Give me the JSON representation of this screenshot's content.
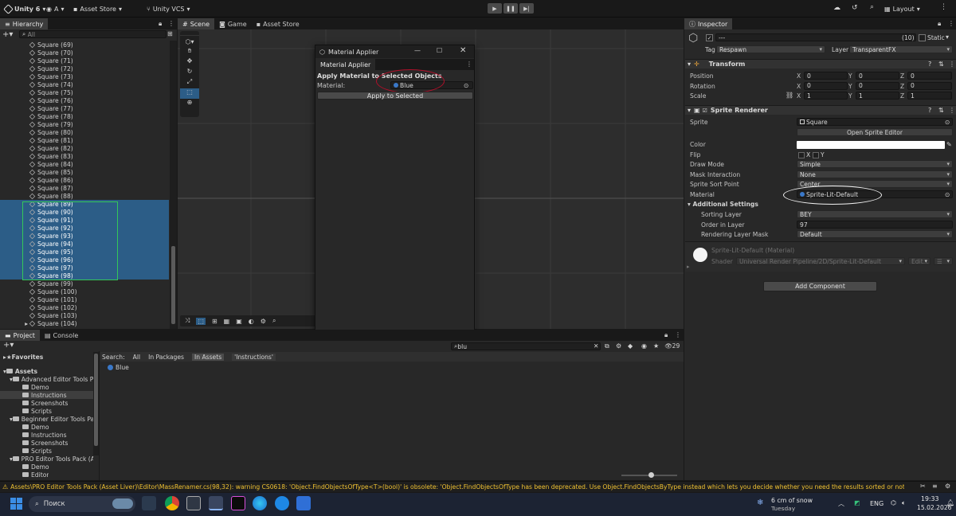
{
  "topbar": {
    "app_name": "Unity 6",
    "account": "A",
    "asset_store": "Asset Store",
    "vcs": "Unity VCS",
    "layout": "Layout"
  },
  "hierarchy": {
    "tab": "Hierarchy",
    "search_placeholder": "All",
    "items": [
      "Square (69)",
      "Square (70)",
      "Square (71)",
      "Square (72)",
      "Square (73)",
      "Square (74)",
      "Square (75)",
      "Square (76)",
      "Square (77)",
      "Square (78)",
      "Square (79)",
      "Square (80)",
      "Square (81)",
      "Square (82)",
      "Square (83)",
      "Square (84)",
      "Square (85)",
      "Square (86)",
      "Square (87)",
      "Square (88)",
      "Square (89)",
      "Square (90)",
      "Square (91)",
      "Square (92)",
      "Square (93)",
      "Square (94)",
      "Square (95)",
      "Square (96)",
      "Square (97)",
      "Square (98)",
      "Square (99)",
      "Square (100)",
      "Square (101)",
      "Square (102)",
      "Square (103)",
      "Square (104)"
    ],
    "selected_from": 20,
    "selected_to": 29
  },
  "scene": {
    "tabs": [
      "Scene",
      "Game",
      "Asset Store"
    ]
  },
  "material_applier": {
    "title": "Material Applier",
    "tab": "Material Applier",
    "heading": "Apply Material to Selected Objects",
    "material_label": "Material:",
    "material_value": "Blue",
    "apply_button": "Apply to Selected"
  },
  "inspector": {
    "tab": "Inspector",
    "object_name": "---",
    "count": "(10)",
    "static_label": "Static",
    "tag_label": "Tag",
    "tag_value": "Respawn",
    "layer_label": "Layer",
    "layer_value": "TransparentFX",
    "transform": {
      "title": "Transform",
      "position_label": "Position",
      "rotation_label": "Rotation",
      "scale_label": "Scale",
      "position": [
        "0",
        "0",
        "0"
      ],
      "rotation": [
        "0",
        "0",
        "0"
      ],
      "scale": [
        "1",
        "1",
        "1"
      ],
      "axes": [
        "X",
        "Y",
        "Z"
      ]
    },
    "sprite_renderer": {
      "title": "Sprite Renderer",
      "sprite_label": "Sprite",
      "sprite_value": "Square",
      "open_editor": "Open Sprite Editor",
      "color_label": "Color",
      "flip_label": "Flip",
      "flip_x": "X",
      "flip_y": "Y",
      "draw_mode_label": "Draw Mode",
      "draw_mode_value": "Simple",
      "mask_label": "Mask Interaction",
      "mask_value": "None",
      "sort_point_label": "Sprite Sort Point",
      "sort_point_value": "Center",
      "material_label": "Material",
      "material_value": "Sprite-Lit-Default",
      "additional": "Additional Settings",
      "sorting_layer_label": "Sorting Layer",
      "sorting_layer_value": "BEY",
      "order_label": "Order in Layer",
      "order_value": "97",
      "rendering_mask_label": "Rendering Layer Mask",
      "rendering_mask_value": "Default"
    },
    "material_block": {
      "name": "Sprite-Lit-Default (Material)",
      "shader_label": "Shader",
      "shader_value": "Universal Render Pipeline/2D/Sprite-Lit-Default",
      "edit": "Edit...",
      "more": "☰"
    },
    "add_component": "Add Component"
  },
  "project": {
    "tabs": [
      "Project",
      "Console"
    ],
    "search_label": "Search:",
    "filters": [
      "All",
      "In Packages",
      "In Assets",
      "'Instructions'"
    ],
    "search_value": "blu",
    "badge": "29",
    "favorites": "Favorites",
    "assets": "Assets",
    "tree": [
      {
        "label": "Advanced Editor Tools P",
        "depth": 1
      },
      {
        "label": "Demo",
        "depth": 2
      },
      {
        "label": "Instructions",
        "depth": 2
      },
      {
        "label": "Screenshots",
        "depth": 2
      },
      {
        "label": "Scripts",
        "depth": 2
      },
      {
        "label": "Beginner Editor Tools Pa",
        "depth": 1
      },
      {
        "label": "Demo",
        "depth": 2
      },
      {
        "label": "Instructions",
        "depth": 2
      },
      {
        "label": "Screenshots",
        "depth": 2
      },
      {
        "label": "Scripts",
        "depth": 2
      },
      {
        "label": "PRO Editor Tools Pack (A",
        "depth": 1
      },
      {
        "label": "Demo",
        "depth": 2
      },
      {
        "label": "Editor",
        "depth": 2
      }
    ],
    "result": "Blue"
  },
  "status": {
    "message": "Assets\\PRO Editor Tools Pack (Asset Liver)\\Editor\\MassRenamer.cs(98,32): warning CS0618: 'Object.FindObjectsOfType<T>(bool)' is obsolete: 'Object.FindObjectsOfType has been deprecated. Use Object.FindObjectsByType instead which lets you decide whether you need the results sorted or not.  FindObjectsOf"
  },
  "taskbar": {
    "search": "Поиск",
    "weather": "6 cm of snow",
    "weather_sub": "Tuesday",
    "lang": "ENG",
    "time": "19:33",
    "date": "15.02.2026"
  },
  "colors": {
    "selection": "#2c5d87",
    "accent_blue": "#3a78c8",
    "warning": "#f0c232"
  }
}
